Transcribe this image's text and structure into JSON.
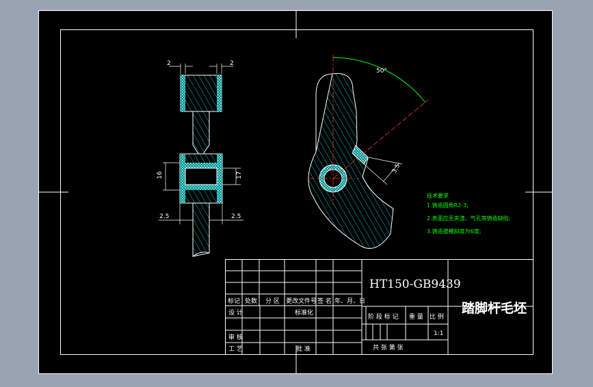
{
  "colors": {
    "background": "#9aa3b1",
    "sheet": "#000000",
    "linework": "#ffffff",
    "hatch": "#00ffff",
    "annotation": "#00ff00"
  },
  "front_view": {
    "dims": {
      "top_left": "2",
      "top_right": "2",
      "left_vertical": "16",
      "right_vertical": "17",
      "bottom_left": "2.5",
      "bottom_right": "2.5"
    }
  },
  "side_view": {
    "angle_label": "50°",
    "offset_label": "3.5"
  },
  "technical_requirements": {
    "title": "技术要求",
    "items": [
      "1.铸造圆角R2-3;",
      "2.表面应无夹渣、气孔等铸造缺陷;",
      "3.铸造拔模斜度为6度;"
    ]
  },
  "title_block": {
    "material": "HT150-GB9439",
    "part_name": "踏脚杆毛坯",
    "revision_headers": [
      "标记",
      "处数",
      "分 区",
      "更改文件号",
      "签 名",
      "年、月、日"
    ],
    "design_label": "设 计",
    "standardization_label": "标准化",
    "review_label": "审 核",
    "process_label": "工 艺",
    "approval_label": "批 准",
    "stage_label": "阶 段 标 记",
    "weight_label": "重 量",
    "scale_label": "比 例",
    "scale_value": "1:1",
    "sheet_info": "共    张  第    张"
  }
}
